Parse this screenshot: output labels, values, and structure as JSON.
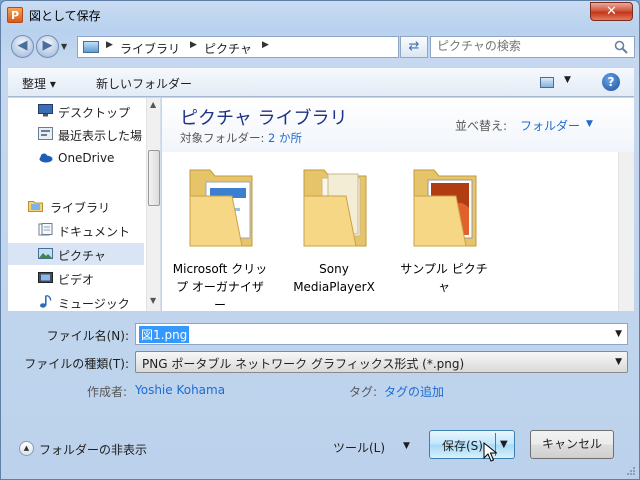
{
  "window": {
    "title": "図として保存",
    "app_icon_letter": "P",
    "close_label": "✕"
  },
  "nav": {
    "back_glyph": "◀",
    "forward_glyph": "▶",
    "breadcrumb": [
      "ライブラリ",
      "ピクチャ"
    ],
    "search_placeholder": "ピクチャの検索"
  },
  "toolbar": {
    "organize_label": "整理 ▾",
    "new_folder_label": "新しいフォルダー",
    "help_label": "?"
  },
  "sidebar": {
    "items": [
      {
        "label": "デスクトップ",
        "icon": "desktop-icon"
      },
      {
        "label": "最近表示した場",
        "icon": "recent-places-icon"
      },
      {
        "label": "OneDrive",
        "icon": "onedrive-cloud-icon"
      },
      {
        "label": "ライブラリ",
        "icon": "libraries-icon"
      },
      {
        "label": "ドキュメント",
        "icon": "documents-icon"
      },
      {
        "label": "ピクチャ",
        "icon": "pictures-icon",
        "selected": true
      },
      {
        "label": "ビデオ",
        "icon": "videos-icon"
      },
      {
        "label": "ミュージック",
        "icon": "music-icon"
      }
    ]
  },
  "content": {
    "library_title": "ピクチャ ライブラリ",
    "target_label": "対象フォルダー:",
    "target_count": "2 か所",
    "sort_label": "並べ替え:",
    "sort_value": "フォルダー",
    "folders": [
      {
        "line1": "Microsoft クリッ",
        "line2": "プ オーガナイザ",
        "line3": "ー",
        "icon": "clip-organizer-folder-icon"
      },
      {
        "line1": "Sony",
        "line2": "MediaPlayerX",
        "line3": "",
        "icon": "sony-folder-icon"
      },
      {
        "line1": "サンプル ピクチ",
        "line2": "ャ",
        "line3": "",
        "icon": "sample-pictures-folder-icon"
      }
    ]
  },
  "form": {
    "filename_label": "ファイル名(N):",
    "filename_value": "図1.png",
    "filetype_label": "ファイルの種類(T):",
    "filetype_value": "PNG ポータブル ネットワーク グラフィックス形式 (*.png)",
    "author_label": "作成者:",
    "author_value": "Yoshie Kohama",
    "tag_label": "タグ:",
    "tag_value": "タグの追加"
  },
  "footer": {
    "hide_folders_label": "フォルダーの非表示",
    "tools_label": "ツール(L)",
    "save_label": "保存(S)",
    "cancel_label": "キャンセル"
  },
  "colors": {
    "link": "#1e6bd0",
    "library_title": "#1e3287",
    "accent_selection": "#3399ff"
  }
}
